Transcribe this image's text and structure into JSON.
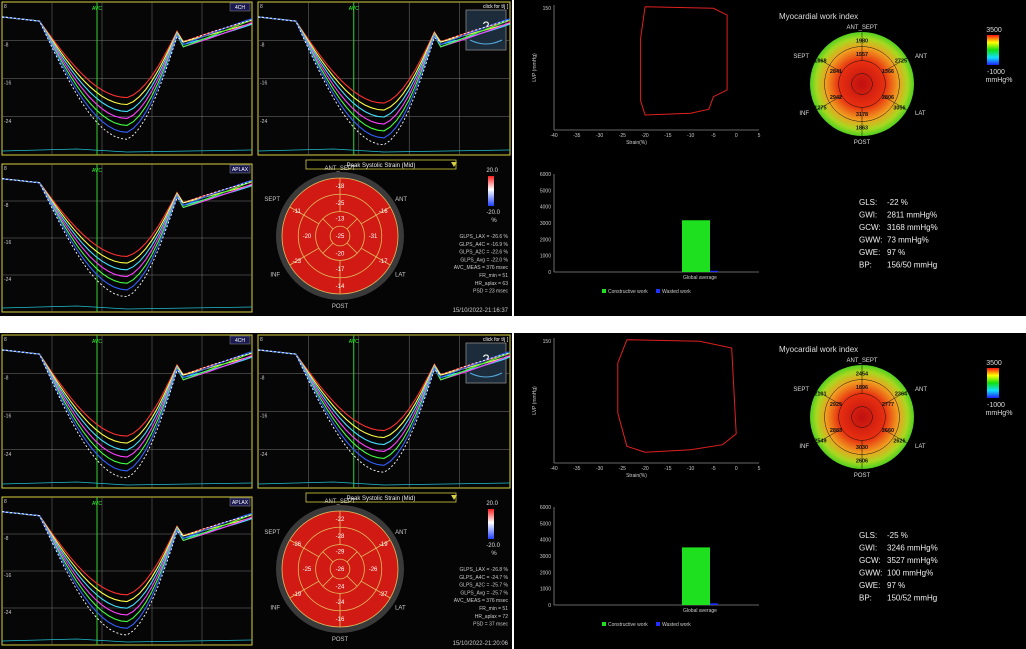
{
  "cases": [
    {
      "echo": {
        "views": [
          "4CH",
          "",
          "APLAX"
        ],
        "avc_label": "AVC",
        "y_ticks": [
          "8",
          "-8",
          "-16",
          "-24"
        ],
        "click_label": "click for t/j [",
        "help_glyph": "?",
        "strain_title": "Peak Systolic Strain (Mid)",
        "scale_top": "20.0",
        "scale_bottom": "-20.0",
        "scale_unit": "%",
        "bullseye_labels": {
          "top": "ANT_SEPT",
          "ant": "ANT",
          "sept": "SEPT",
          "inf": "INF",
          "lat": "LAT",
          "post": "POST"
        },
        "bullseye_values": [
          "-18",
          "-16",
          "-17",
          "-14",
          "-23",
          "-11",
          "-25",
          "-31",
          "-17",
          "-20",
          "-13",
          "-20",
          "-25"
        ],
        "stats": [
          "GLPS_LAX = -26.6 %",
          "GLPS_A4C = -16.9 %",
          "GLPS_A2C = -22.6 %",
          "GLPS_Avg = -22.0 %",
          "AVC_MEAS = 376 msec",
          "FR_min = 51",
          "HR_aplax = 63",
          "PSD = 23 msec"
        ],
        "timestamp": "15/10/2022-21:16:37"
      },
      "work": {
        "title": "Myocardial work index",
        "scale_max": "3500",
        "scale_min": "-1000",
        "scale_unit": "mmHg%",
        "loop_ylabel": "LVP (mmHg)",
        "loop_xlabel": "Strain(%)",
        "loop_y_top": "150",
        "loop_x_ticks": [
          "-40",
          "-35",
          "-30",
          "-25",
          "-20",
          "-15",
          "-10",
          "-5",
          "0",
          "5"
        ],
        "loop_x_domain": [
          -40,
          5
        ],
        "loop_y_domain": [
          0,
          150
        ],
        "loop_points": [
          [
            -20,
            148
          ],
          [
            -5,
            146
          ],
          [
            -2,
            138
          ],
          [
            -2,
            48
          ],
          [
            -5,
            40
          ],
          [
            -6,
            25
          ],
          [
            -10,
            20
          ],
          [
            -20,
            18
          ],
          [
            -21,
            35
          ],
          [
            -21,
            110
          ],
          [
            -20,
            148
          ]
        ],
        "bar_ticks": [
          "6000",
          "5000",
          "4000",
          "3000",
          "2000",
          "1000",
          "0"
        ],
        "bar_values": {
          "constructive": 3168,
          "wasted": 73
        },
        "bar_category": "Global average",
        "legend": [
          "Constructive work",
          "Wasted work"
        ],
        "mw_labels": {
          "top": "ANT_SEPT",
          "ant": "ANT",
          "sept": "SEPT",
          "inf": "INF",
          "lat": "LAT",
          "post": "POST"
        },
        "mw_values": [
          "1980",
          "1668",
          "2725",
          "1275",
          "1863",
          "3056",
          "1557",
          "1366",
          "2806",
          "3178",
          "2942",
          "2841"
        ],
        "metrics": [
          {
            "k": "GLS:",
            "v": "-22 %"
          },
          {
            "k": "GWI:",
            "v": "2811 mmHg%"
          },
          {
            "k": "GCW:",
            "v": "3168 mmHg%"
          },
          {
            "k": "GWW:",
            "v": "73 mmHg%"
          },
          {
            "k": "GWE:",
            "v": "97 %"
          },
          {
            "k": "BP:",
            "v": "156/50 mmHg"
          }
        ]
      }
    },
    {
      "echo": {
        "views": [
          "4CH",
          "",
          "APLAX"
        ],
        "avc_label": "AVC",
        "y_ticks": [
          "8",
          "-8",
          "-16",
          "-24"
        ],
        "click_label": "click for t/j [",
        "help_glyph": "?",
        "strain_title": "Peak Systolic Strain (Mid)",
        "scale_top": "20.0",
        "scale_bottom": "-20.0",
        "scale_unit": "%",
        "bullseye_labels": {
          "top": "ANT_SEPT",
          "ant": "ANT",
          "sept": "SEPT",
          "inf": "INF",
          "lat": "LAT",
          "post": "POST"
        },
        "bullseye_values": [
          "-22",
          "-19",
          "-27",
          "-16",
          "-19",
          "-26",
          "-28",
          "-26",
          "-24",
          "-25",
          "-29",
          "-24",
          "-26"
        ],
        "stats": [
          "GLPS_LAX = -26.8 %",
          "GLPS_A4C = -24.7 %",
          "GLPS_A2C = -25.7 %",
          "GLPS_Avg = -25.7 %",
          "AVC_MEAS = 376 msec",
          "FR_min = 51",
          "HR_aplax = 72",
          "PSD = 37 msec"
        ],
        "timestamp": "15/10/2022-21:20:06"
      },
      "work": {
        "title": "Myocardial work index",
        "scale_max": "3500",
        "scale_min": "-1000",
        "scale_unit": "mmHg%",
        "loop_ylabel": "LVP (mmHg)",
        "loop_xlabel": "Strain(%)",
        "loop_y_top": "150",
        "loop_x_ticks": [
          "-40",
          "-35",
          "-30",
          "-25",
          "-20",
          "-15",
          "-10",
          "-5",
          "0",
          "5"
        ],
        "loop_x_domain": [
          -40,
          5
        ],
        "loop_y_domain": [
          0,
          150
        ],
        "loop_points": [
          [
            -24,
            148
          ],
          [
            -8,
            146
          ],
          [
            -1,
            138
          ],
          [
            0,
            35
          ],
          [
            -3,
            22
          ],
          [
            -10,
            16
          ],
          [
            -20,
            13
          ],
          [
            -24,
            20
          ],
          [
            -26,
            60
          ],
          [
            -26,
            120
          ],
          [
            -24,
            148
          ]
        ],
        "bar_ticks": [
          "6000",
          "5000",
          "4000",
          "3000",
          "2000",
          "1000",
          "0"
        ],
        "bar_values": {
          "constructive": 3527,
          "wasted": 100
        },
        "bar_category": "Global average",
        "legend": [
          "Constructive work",
          "Wasted work"
        ],
        "mw_labels": {
          "top": "ANT_SEPT",
          "ant": "ANT",
          "sept": "SEPT",
          "inf": "INF",
          "lat": "LAT",
          "post": "POST"
        },
        "mw_values": [
          "2454",
          "2101",
          "2364",
          "2549",
          "2606",
          "2626",
          "1896",
          "2777",
          "2660",
          "3030",
          "2883",
          "2925"
        ],
        "metrics": [
          {
            "k": "GLS:",
            "v": "-25 %"
          },
          {
            "k": "GWI:",
            "v": "3246 mmHg%"
          },
          {
            "k": "GCW:",
            "v": "3527 mmHg%"
          },
          {
            "k": "GWW:",
            "v": "100 mmHg%"
          },
          {
            "k": "GWE:",
            "v": "97 %"
          },
          {
            "k": "BP:",
            "v": "150/52 mmHg"
          }
        ]
      }
    }
  ]
}
